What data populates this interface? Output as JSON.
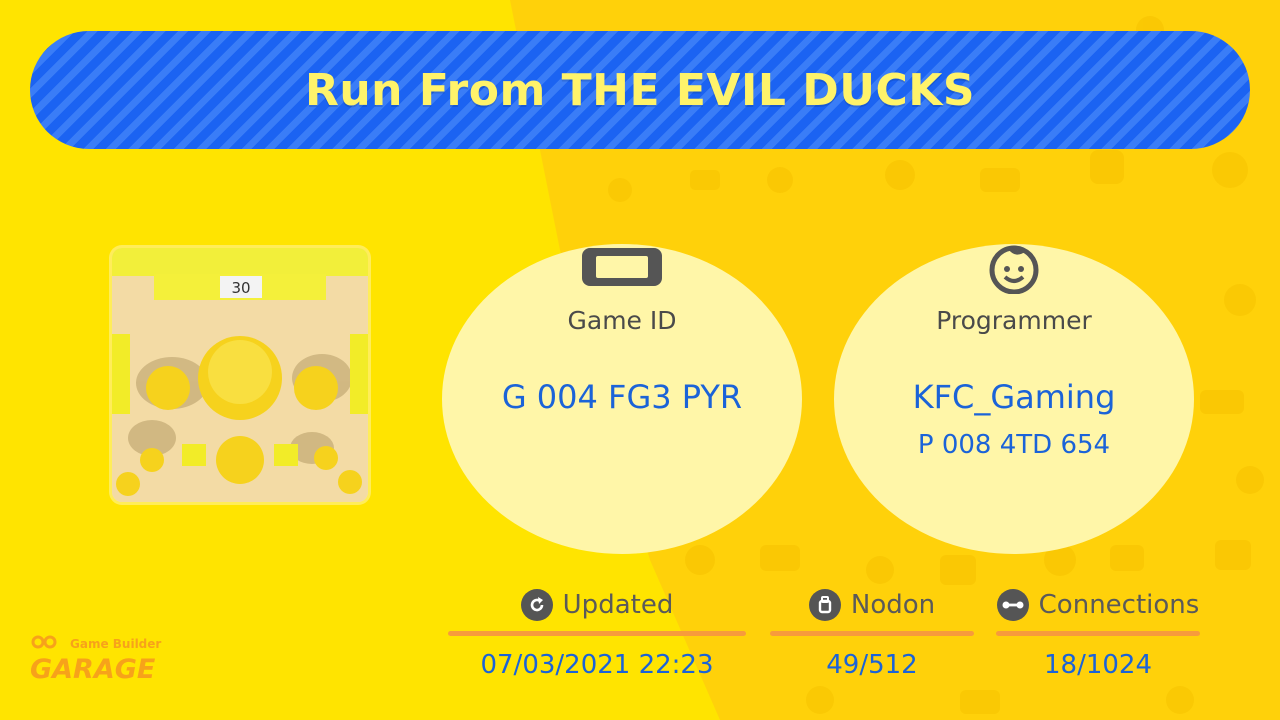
{
  "title": "Run From THE EVIL DUCKS",
  "thumbnail": {
    "timer": "30"
  },
  "game": {
    "label": "Game ID",
    "id": "G 004 FG3 PYR",
    "icon": "console-icon"
  },
  "programmer": {
    "label": "Programmer",
    "name": "KFC_Gaming",
    "id": "P 008 4TD 654",
    "icon": "face-icon"
  },
  "stats": [
    {
      "label": "Updated",
      "value": "07/03/2021 22:23",
      "icon": "refresh-icon"
    },
    {
      "label": "Nodon",
      "value": "49/512",
      "icon": "nodon-icon"
    },
    {
      "label": "Connections",
      "value": "18/1024",
      "icon": "connection-icon"
    }
  ],
  "logo": {
    "line1": "Game Builder",
    "line2": "GARAGE"
  },
  "colors": {
    "background": "#ffe400",
    "banner": "#1b63f2",
    "title_text": "#fff36a",
    "value_text": "#1b63d8",
    "circle": "#fff6a8",
    "bar": "#f79b3c"
  }
}
